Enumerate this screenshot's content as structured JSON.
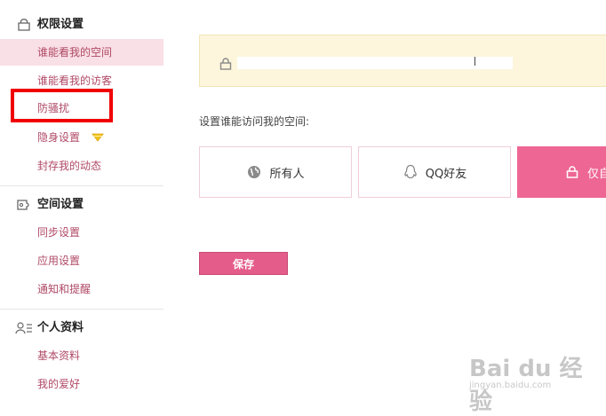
{
  "sidebar": {
    "sections": [
      {
        "title": "权限设置",
        "icon": "lock-icon"
      },
      {
        "title": "空间设置",
        "icon": "puzzle-icon"
      },
      {
        "title": "个人资料",
        "icon": "profile-icon"
      }
    ],
    "privacy_items": [
      {
        "label": "谁能看我的空间"
      },
      {
        "label": "谁能看我的访客"
      },
      {
        "label": "防骚扰"
      },
      {
        "label": "隐身设置"
      },
      {
        "label": "封存我的动态"
      }
    ],
    "space_items": [
      {
        "label": "同步设置"
      },
      {
        "label": "应用设置"
      },
      {
        "label": "通知和提醒"
      }
    ],
    "profile_items": [
      {
        "label": "基本资料"
      },
      {
        "label": "我的爱好"
      }
    ]
  },
  "main": {
    "prompt": "设置谁能访问我的空间:",
    "options": [
      {
        "label": "所有人",
        "icon": "globe-icon"
      },
      {
        "label": "QQ好友",
        "icon": "qq-penguin-icon"
      },
      {
        "label": "仅自",
        "icon": "lock-icon"
      }
    ],
    "save_label": "保存"
  },
  "watermark": {
    "text": "Bai du 经验",
    "url": "jingyan.baidu.com"
  },
  "colors": {
    "accent": "#ee6694",
    "active_bg": "#f9dfe6",
    "link": "#b04a66",
    "notice_bg": "#fdf6dc",
    "highlight": "#f00000"
  }
}
